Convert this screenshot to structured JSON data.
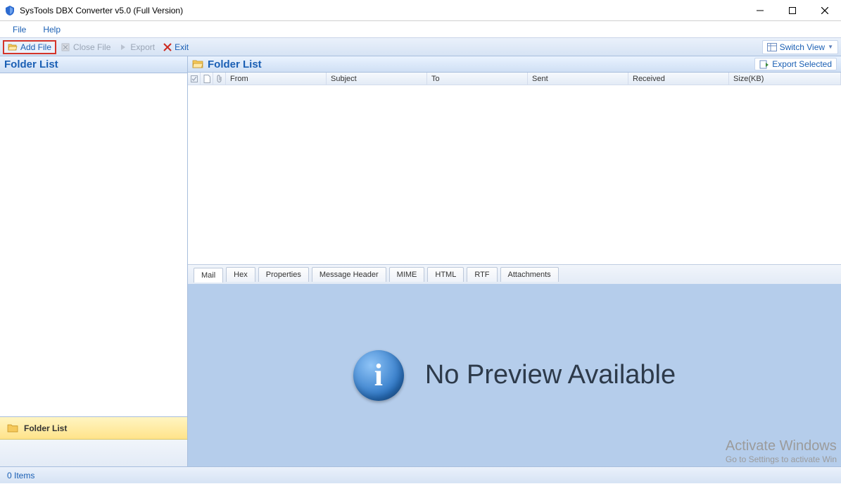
{
  "title": "SysTools DBX Converter v5.0 (Full Version)",
  "menu": {
    "file": "File",
    "help": "Help"
  },
  "toolbar": {
    "add_file": "Add File",
    "close_file": "Close File",
    "export": "Export",
    "exit": "Exit",
    "switch_view": "Switch View"
  },
  "sidebar": {
    "header": "Folder List",
    "tab1": "Folder List"
  },
  "list": {
    "header_title": "Folder List",
    "export_selected": "Export Selected",
    "cols": {
      "from": "From",
      "subject": "Subject",
      "to": "To",
      "sent": "Sent",
      "received": "Received",
      "size": "Size(KB)"
    }
  },
  "preview": {
    "tabs": {
      "mail": "Mail",
      "hex": "Hex",
      "properties": "Properties",
      "message_header": "Message Header",
      "mime": "MIME",
      "html": "HTML",
      "rtf": "RTF",
      "attachments": "Attachments"
    },
    "message": "No Preview Available"
  },
  "status": {
    "items": "0 Items"
  },
  "watermark": {
    "l1": "Activate Windows",
    "l2": "Go to Settings to activate Win"
  }
}
